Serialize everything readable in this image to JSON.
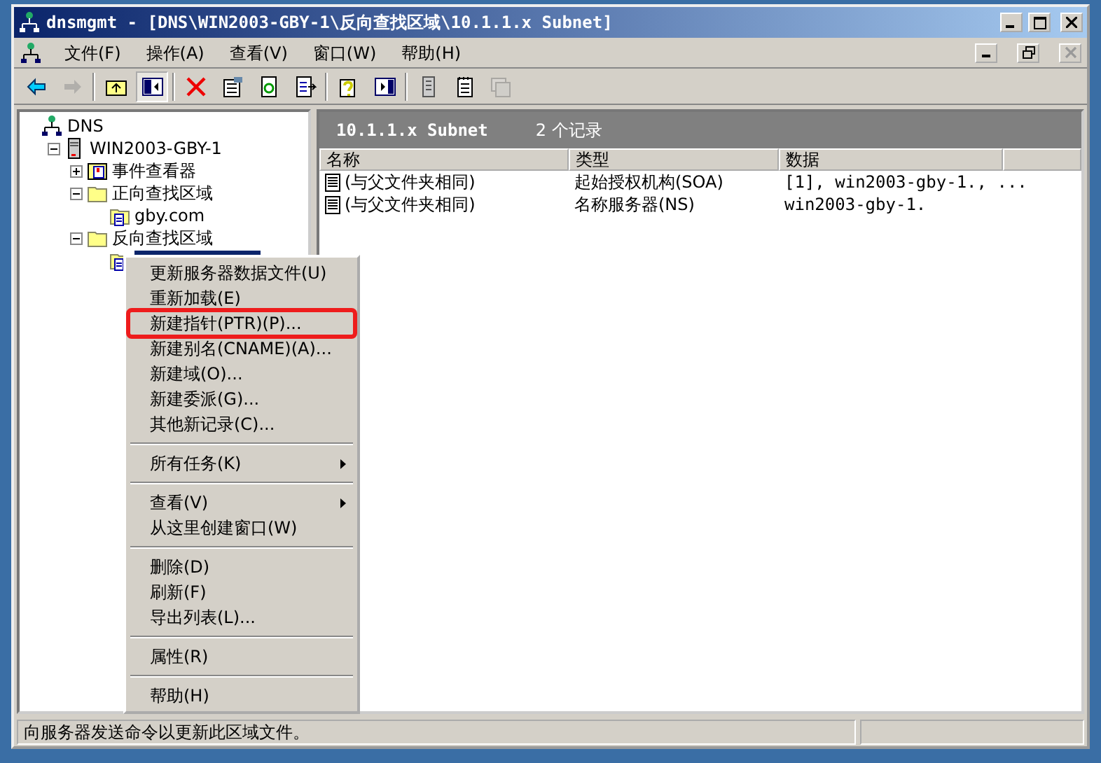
{
  "window": {
    "title": "dnsmgmt - [DNS\\WIN2003-GBY-1\\反向查找区域\\10.1.1.x Subnet]"
  },
  "menu_bar": [
    "文件(F)",
    "操作(A)",
    "查看(V)",
    "窗口(W)",
    "帮助(H)"
  ],
  "toolbar": [
    {
      "disabled": false,
      "pressed": false
    },
    {
      "disabled": true,
      "pressed": false
    },
    {
      "disabled": false,
      "pressed": false
    },
    {
      "disabled": false,
      "pressed": true
    },
    {
      "disabled": false,
      "pressed": false
    },
    {
      "disabled": false,
      "pressed": false
    },
    {
      "disabled": false,
      "pressed": false
    },
    {
      "disabled": false,
      "pressed": false
    },
    {
      "disabled": false,
      "pressed": false
    },
    {
      "disabled": false,
      "pressed": false
    },
    {
      "disabled": false,
      "pressed": false
    },
    {
      "disabled": false,
      "pressed": false
    },
    {
      "disabled": true,
      "pressed": false
    }
  ],
  "tree": [
    {
      "label": "DNS",
      "kind": "dns",
      "selected": false,
      "children": [
        {
          "label": "WIN2003-GBY-1",
          "kind": "server",
          "expanded": true,
          "selected": false,
          "children": [
            {
              "label": "事件查看器",
              "kind": "event",
              "expanded": false,
              "selected": false
            },
            {
              "label": "正向查找区域",
              "kind": "folder",
              "expanded": true,
              "selected": false,
              "children": [
                {
                  "label": "gby.com",
                  "kind": "zone",
                  "selected": false
                }
              ]
            },
            {
              "label": "反向查找区域",
              "kind": "folder",
              "expanded": true,
              "selected": false,
              "children": [
                {
                  "kind": "zone",
                  "selected": true
                }
              ]
            }
          ]
        }
      ]
    }
  ],
  "details": {
    "title": "10.1.1.x Subnet",
    "count": "2 个记录",
    "columns": [
      "名称",
      "类型",
      "数据"
    ],
    "rows": [
      [
        "(与父文件夹相同)",
        "起始授权机构(SOA)",
        "[1], win2003-gby-1., ..."
      ],
      [
        "(与父文件夹相同)",
        "名称服务器(NS)",
        "win2003-gby-1."
      ]
    ]
  },
  "context_menu": [
    {
      "kind": "item",
      "label": "更新服务器数据文件(U)",
      "outlined": false
    },
    {
      "kind": "item",
      "label": "重新加载(E)",
      "outlined": false
    },
    {
      "kind": "item",
      "label": "新建指针(PTR)(P)...",
      "outlined": true
    },
    {
      "kind": "item",
      "label": "新建别名(CNAME)(A)...",
      "outlined": false
    },
    {
      "kind": "item",
      "label": "新建域(O)...",
      "outlined": false
    },
    {
      "kind": "item",
      "label": "新建委派(G)...",
      "outlined": false
    },
    {
      "kind": "item",
      "label": "其他新记录(C)...",
      "outlined": false
    },
    {
      "kind": "separator"
    },
    {
      "kind": "submenu",
      "label": "所有任务(K)",
      "outlined": false
    },
    {
      "kind": "separator"
    },
    {
      "kind": "submenu",
      "label": "查看(V)",
      "outlined": false
    },
    {
      "kind": "item",
      "label": "从这里创建窗口(W)",
      "outlined": false
    },
    {
      "kind": "separator"
    },
    {
      "kind": "item",
      "label": "删除(D)",
      "outlined": false
    },
    {
      "kind": "item",
      "label": "刷新(F)",
      "outlined": false
    },
    {
      "kind": "item",
      "label": "导出列表(L)...",
      "outlined": false
    },
    {
      "kind": "separator"
    },
    {
      "kind": "item",
      "label": "属性(R)",
      "outlined": false
    },
    {
      "kind": "separator"
    },
    {
      "kind": "item",
      "label": "帮助(H)",
      "outlined": false
    }
  ],
  "status_bar": "向服务器发送命令以更新此区域文件。"
}
